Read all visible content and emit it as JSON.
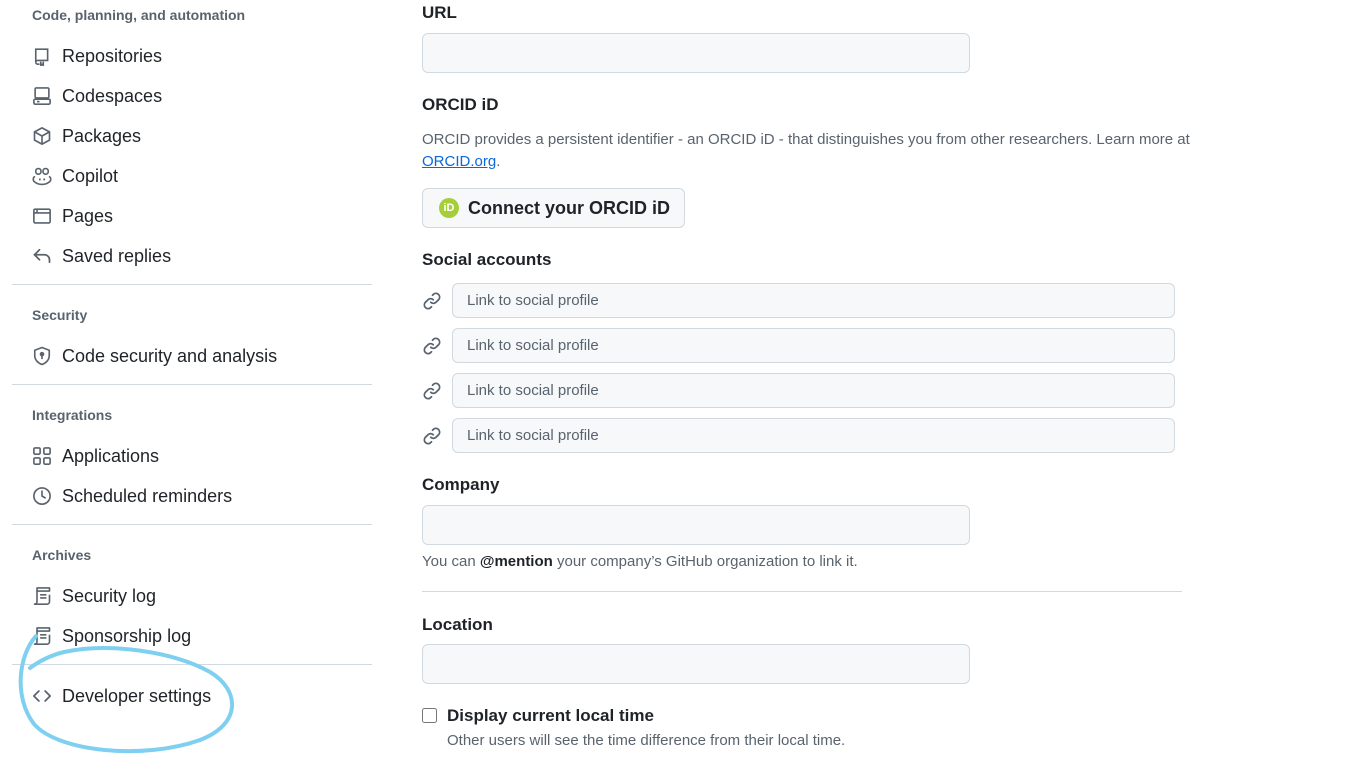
{
  "sidebar": {
    "sections": [
      {
        "heading": "Code, planning, and automation",
        "items": [
          {
            "label": "Repositories",
            "icon": "repo-icon"
          },
          {
            "label": "Codespaces",
            "icon": "codespaces-icon"
          },
          {
            "label": "Packages",
            "icon": "package-icon"
          },
          {
            "label": "Copilot",
            "icon": "copilot-icon"
          },
          {
            "label": "Pages",
            "icon": "browser-icon"
          },
          {
            "label": "Saved replies",
            "icon": "reply-icon"
          }
        ]
      },
      {
        "heading": "Security",
        "items": [
          {
            "label": "Code security and analysis",
            "icon": "shield-icon"
          }
        ]
      },
      {
        "heading": "Integrations",
        "items": [
          {
            "label": "Applications",
            "icon": "apps-icon"
          },
          {
            "label": "Scheduled reminders",
            "icon": "clock-icon"
          }
        ]
      },
      {
        "heading": "Archives",
        "items": [
          {
            "label": "Security log",
            "icon": "log-icon"
          },
          {
            "label": "Sponsorship log",
            "icon": "log-icon"
          }
        ]
      }
    ],
    "developer_settings": {
      "label": "Developer settings",
      "icon": "code-icon"
    }
  },
  "form": {
    "url": {
      "label": "URL",
      "value": ""
    },
    "orcid": {
      "label": "ORCID iD",
      "description": "ORCID provides a persistent identifier - an ORCID iD - that distinguishes you from other researchers. Learn more at",
      "link_text": "ORCID.org",
      "link_suffix": ".",
      "button_label": "Connect your ORCID iD",
      "badge_text": "iD"
    },
    "social": {
      "label": "Social accounts",
      "placeholders": [
        "Link to social profile",
        "Link to social profile",
        "Link to social profile",
        "Link to social profile"
      ]
    },
    "company": {
      "label": "Company",
      "value": "",
      "help_prefix": "You can",
      "help_mention": "@mention",
      "help_suffix": "your company’s GitHub organization to link it."
    },
    "location": {
      "label": "Location",
      "value": ""
    },
    "local_time": {
      "label": "Display current local time",
      "checked": false,
      "help": "Other users will see the time difference from their local time."
    }
  },
  "colors": {
    "accent_link": "#0969da",
    "annotation_circle": "#7fd0f0",
    "orcid_green": "#a6ce39"
  }
}
